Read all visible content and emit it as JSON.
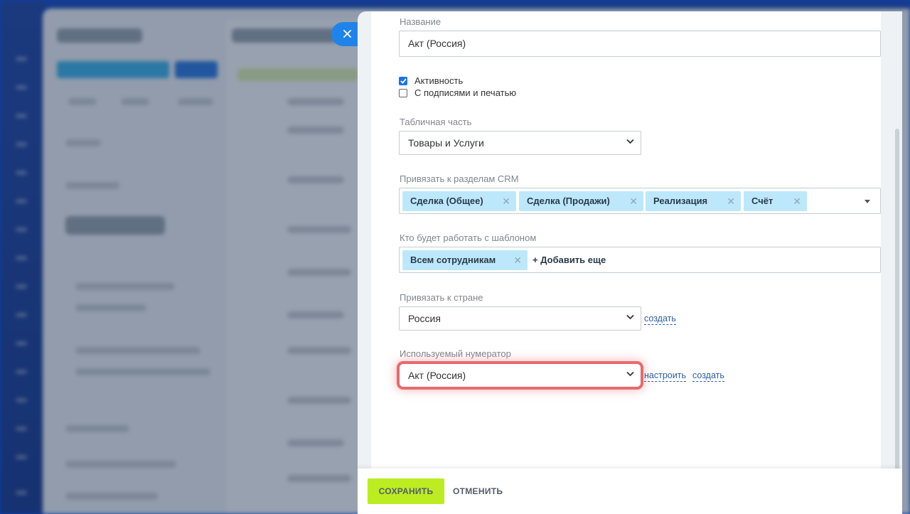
{
  "form": {
    "name_label": "Название",
    "name_value": "Акт (Россия)",
    "active_label": "Активность",
    "active_checked": true,
    "signed_label": "С подписями и печатью",
    "signed_checked": false,
    "table_label": "Табличная часть",
    "table_value": "Товары и Услуги",
    "crm_label": "Привязать к разделам CRM",
    "crm_tags": [
      "Сделка (Общее)",
      "Сделка (Продажи)",
      "Реализация",
      "Счёт"
    ],
    "users_label": "Кто будет работать с шаблоном",
    "users_tags": [
      "Всем сотрудникам"
    ],
    "add_more": "+ Добавить еще",
    "country_label": "Привязать к стране",
    "country_value": "Россия",
    "create_link": "создать",
    "numerator_label": "Используемый нумератор",
    "numerator_value": "Акт (Россия)",
    "configure_link": "настроить",
    "create_link_2": "создать"
  },
  "footer": {
    "save": "СОХРАНИТЬ",
    "cancel": "ОТМЕНИТЬ"
  },
  "icons": {
    "close": "close-icon",
    "chevron": "chevron-down-icon",
    "remove": "close-icon"
  },
  "colors": {
    "accent": "#1a73e8",
    "save_button": "#bbed21",
    "tag_bg": "#bde8fb",
    "highlight": "#e86a6f"
  }
}
